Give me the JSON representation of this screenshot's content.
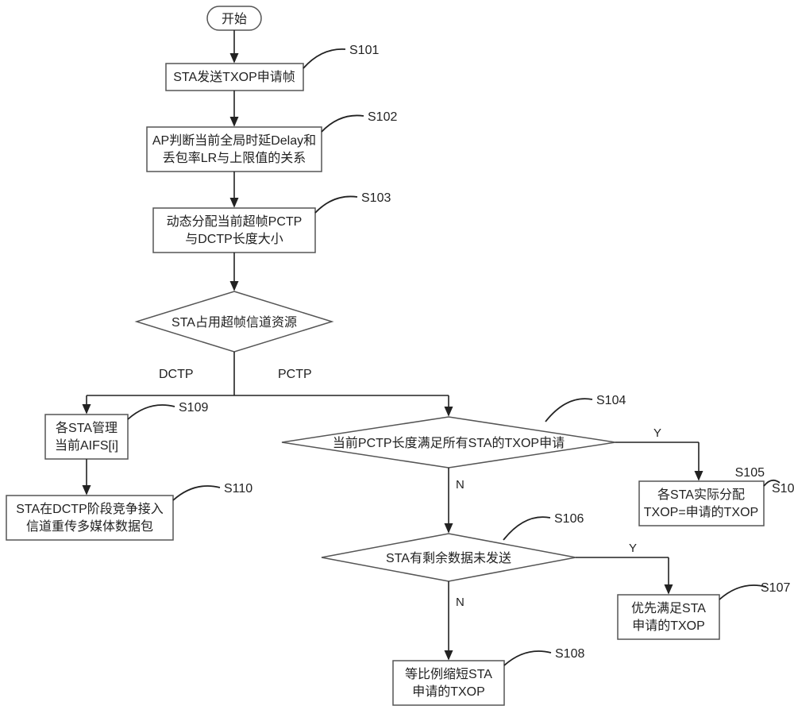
{
  "start": "开始",
  "s101": {
    "text": "STA发送TXOP申请帧",
    "label": "S101"
  },
  "s102": {
    "line1": "AP判断当前全局时延Delay和",
    "line2": "丢包率LR与上限值的关系",
    "label": "S102"
  },
  "s103": {
    "line1": "动态分配当前超帧PCTP",
    "line2": "与DCTP长度大小",
    "label": "S103"
  },
  "decision1": "STA占用超帧信道资源",
  "branch_left": "DCTP",
  "branch_right": "PCTP",
  "s109": {
    "line1": "各STA管理",
    "line2": "当前AIFS[i]",
    "label": "S109"
  },
  "s110": {
    "line1": "STA在DCTP阶段竞争接入",
    "line2": "信道重传多媒体数据包",
    "label": "S110"
  },
  "s104": {
    "text": "当前PCTP长度满足所有STA的TXOP申请",
    "label": "S104"
  },
  "s105": {
    "line1": "各STA实际分配",
    "line2": "TXOP=申请的TXOP",
    "label": "S105"
  },
  "s106": {
    "text": "STA有剩余数据未发送",
    "label": "S106"
  },
  "s107": {
    "line1": "优先满足STA",
    "line2": "申请的TXOP",
    "label": "S107"
  },
  "s108": {
    "line1": "等比例缩短STA",
    "line2": "申请的TXOP",
    "label": "S108"
  },
  "yes": "Y",
  "no": "N"
}
